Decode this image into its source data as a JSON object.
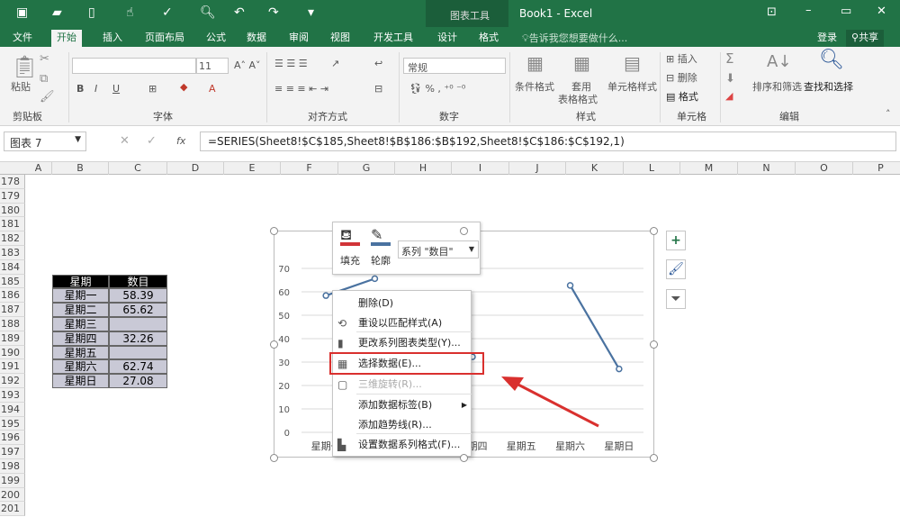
{
  "titlebar": {
    "context_tools": "图表工具",
    "title": "Book1 - Excel",
    "quick_access": [
      "save-icon",
      "open-icon",
      "new-icon",
      "touch-icon",
      "spelling-icon",
      "print-preview-icon",
      "undo-icon",
      "redo-icon",
      "customize-icon"
    ]
  },
  "tabs": [
    "文件",
    "开始",
    "插入",
    "页面布局",
    "公式",
    "数据",
    "审阅",
    "视图",
    "开发工具",
    "设计",
    "格式"
  ],
  "tell_me": "告诉我您想要做什么...",
  "signin": "登录",
  "share": "共享",
  "ribbon": {
    "paste": "粘贴",
    "groups": [
      "剪贴板",
      "字体",
      "对齐方式",
      "数字",
      "样式",
      "单元格",
      "编辑"
    ],
    "font_size": "11",
    "number_format": "常规",
    "cond_format": "条件格式",
    "table_format_1": "套用",
    "table_format_2": "表格格式",
    "cell_styles": "单元格样式",
    "insert": "插入",
    "delete": "删除",
    "format": "格式",
    "sort_filter": "排序和筛选",
    "find_select": "查找和选择"
  },
  "formula_bar": {
    "name_box": "图表 7",
    "fx": "fx",
    "formula": "=SERIES(Sheet8!$C$185,Sheet8!$B$186:$B$192,Sheet8!$C$186:$C$192,1)"
  },
  "columns": [
    "A",
    "B",
    "C",
    "D",
    "E",
    "F",
    "G",
    "H",
    "I",
    "J",
    "K",
    "L",
    "M",
    "N",
    "O",
    "P"
  ],
  "rows": [
    "178",
    "179",
    "180",
    "181",
    "182",
    "183",
    "184",
    "185",
    "186",
    "187",
    "188",
    "189",
    "190",
    "191",
    "192",
    "193",
    "194",
    "195",
    "196",
    "197",
    "198",
    "199",
    "200",
    "201"
  ],
  "table": {
    "headers": [
      "星期",
      "数目"
    ],
    "rows": [
      [
        "星期一",
        "58.39"
      ],
      [
        "星期二",
        "65.62"
      ],
      [
        "星期三",
        ""
      ],
      [
        "星期四",
        "32.26"
      ],
      [
        "星期五",
        ""
      ],
      [
        "星期六",
        "62.74"
      ],
      [
        "星期日",
        "27.08"
      ]
    ]
  },
  "chart_data": {
    "type": "line",
    "categories": [
      "星期一",
      "星期二",
      "星期三",
      "星期四",
      "星期五",
      "星期六",
      "星期日"
    ],
    "values": [
      58.39,
      65.62,
      null,
      32.26,
      null,
      62.74,
      27.08
    ],
    "yticks": [
      "0",
      "10",
      "20",
      "30",
      "40",
      "50",
      "60",
      "70"
    ],
    "ylim": [
      0,
      70
    ],
    "series_name": "数目",
    "line_color": "#4a72a0"
  },
  "mini_toolbar": {
    "fill": "填充",
    "outline": "轮廓",
    "series_select": "系列 \"数目\""
  },
  "context_menu": [
    {
      "label": "删除(D)",
      "icon": "",
      "disabled": false
    },
    {
      "label": "重设以匹配样式(A)",
      "icon": "reset-style-icon",
      "disabled": false
    },
    {
      "label": "更改系列图表类型(Y)...",
      "icon": "chart-type-icon",
      "disabled": false
    },
    {
      "label": "选择数据(E)...",
      "icon": "select-data-icon",
      "disabled": false
    },
    {
      "label": "三维旋转(R)...",
      "icon": "3d-rotation-icon",
      "disabled": true
    },
    {
      "label": "添加数据标签(B)",
      "icon": "",
      "disabled": false
    },
    {
      "label": "添加趋势线(R)...",
      "icon": "",
      "disabled": false
    },
    {
      "label": "设置数据系列格式(F)...",
      "icon": "format-series-icon",
      "disabled": false
    }
  ],
  "colors": {
    "brand": "#217346",
    "highlight": "#d9302e"
  }
}
